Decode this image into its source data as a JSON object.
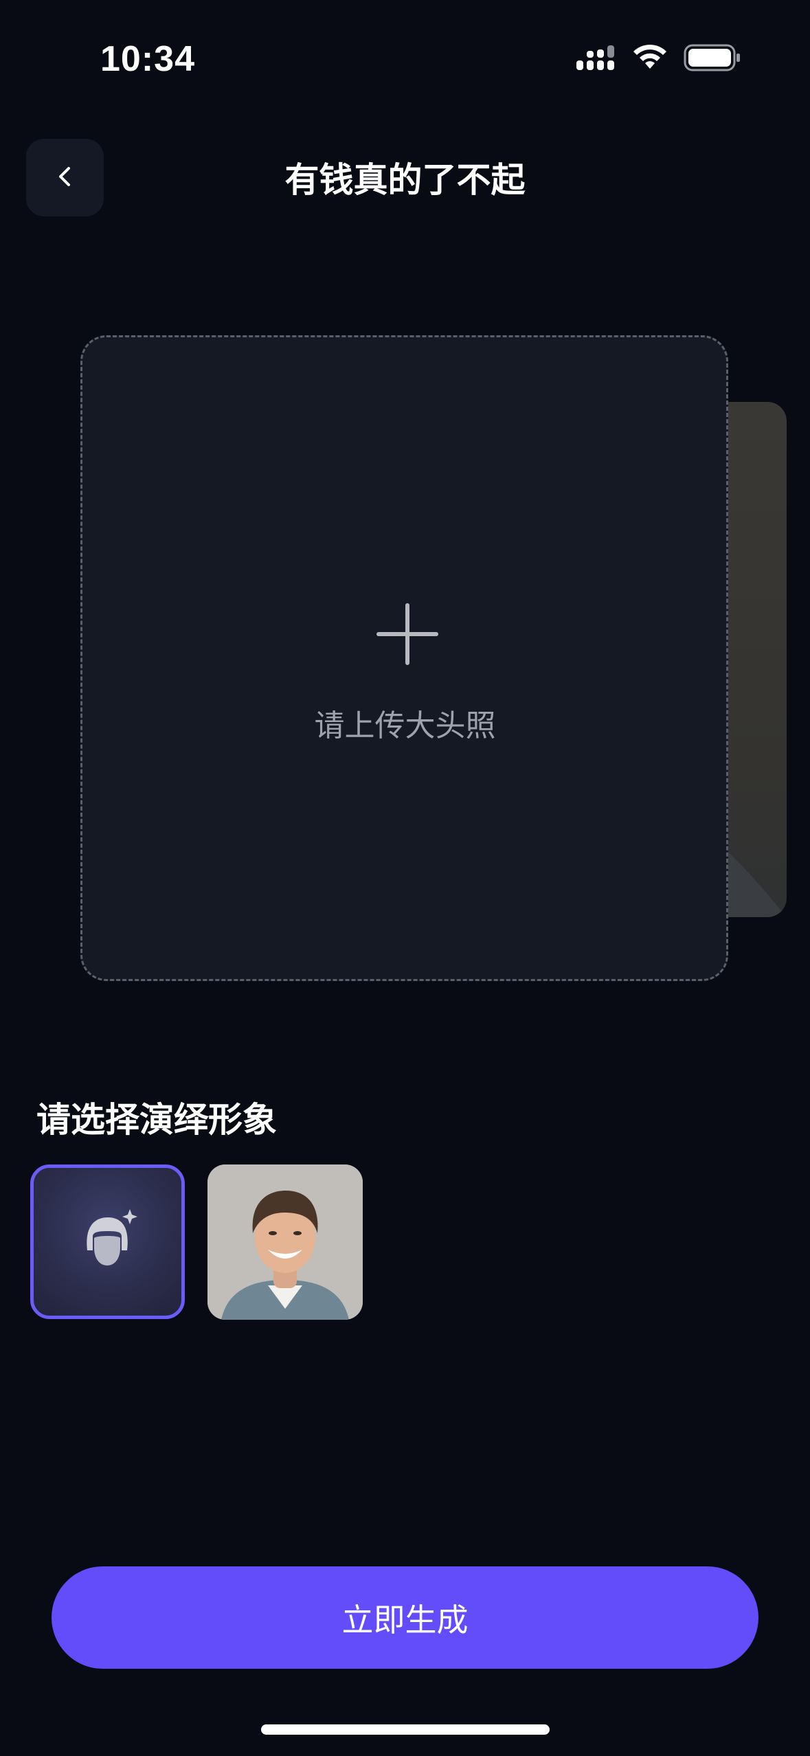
{
  "status_bar": {
    "time": "10:34",
    "icons": [
      "cellular-signal-icon",
      "wifi-icon",
      "battery-icon"
    ]
  },
  "header": {
    "back_icon": "chevron-left-icon",
    "title": "有钱真的了不起"
  },
  "upload": {
    "icon": "plus-icon",
    "label": "请上传大头照"
  },
  "avatar_section": {
    "title": "请选择演绎形象",
    "items": [
      {
        "type": "default-avatar",
        "icon": "avatar-sparkle-icon",
        "selected": true
      },
      {
        "type": "photo",
        "selected": false
      }
    ]
  },
  "actions": {
    "generate_label": "立即生成"
  },
  "colors": {
    "background": "#080b14",
    "accent": "#634cfa",
    "selected_border": "#6a5cf7",
    "card": "#151923"
  }
}
